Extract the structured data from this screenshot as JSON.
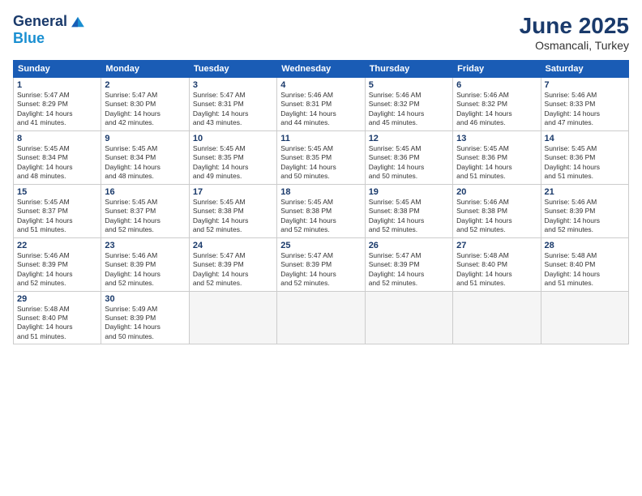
{
  "logo": {
    "line1": "General",
    "line2": "Blue"
  },
  "title": "June 2025",
  "subtitle": "Osmancali, Turkey",
  "weekdays": [
    "Sunday",
    "Monday",
    "Tuesday",
    "Wednesday",
    "Thursday",
    "Friday",
    "Saturday"
  ],
  "days": [
    {
      "num": "",
      "info": ""
    },
    {
      "num": "",
      "info": ""
    },
    {
      "num": "",
      "info": ""
    },
    {
      "num": "",
      "info": ""
    },
    {
      "num": "",
      "info": ""
    },
    {
      "num": "",
      "info": ""
    },
    {
      "num": "",
      "info": ""
    },
    {
      "num": "1",
      "info": "Sunrise: 5:47 AM\nSunset: 8:29 PM\nDaylight: 14 hours\nand 41 minutes."
    },
    {
      "num": "2",
      "info": "Sunrise: 5:47 AM\nSunset: 8:30 PM\nDaylight: 14 hours\nand 42 minutes."
    },
    {
      "num": "3",
      "info": "Sunrise: 5:47 AM\nSunset: 8:31 PM\nDaylight: 14 hours\nand 43 minutes."
    },
    {
      "num": "4",
      "info": "Sunrise: 5:46 AM\nSunset: 8:31 PM\nDaylight: 14 hours\nand 44 minutes."
    },
    {
      "num": "5",
      "info": "Sunrise: 5:46 AM\nSunset: 8:32 PM\nDaylight: 14 hours\nand 45 minutes."
    },
    {
      "num": "6",
      "info": "Sunrise: 5:46 AM\nSunset: 8:32 PM\nDaylight: 14 hours\nand 46 minutes."
    },
    {
      "num": "7",
      "info": "Sunrise: 5:46 AM\nSunset: 8:33 PM\nDaylight: 14 hours\nand 47 minutes."
    },
    {
      "num": "8",
      "info": "Sunrise: 5:45 AM\nSunset: 8:34 PM\nDaylight: 14 hours\nand 48 minutes."
    },
    {
      "num": "9",
      "info": "Sunrise: 5:45 AM\nSunset: 8:34 PM\nDaylight: 14 hours\nand 48 minutes."
    },
    {
      "num": "10",
      "info": "Sunrise: 5:45 AM\nSunset: 8:35 PM\nDaylight: 14 hours\nand 49 minutes."
    },
    {
      "num": "11",
      "info": "Sunrise: 5:45 AM\nSunset: 8:35 PM\nDaylight: 14 hours\nand 50 minutes."
    },
    {
      "num": "12",
      "info": "Sunrise: 5:45 AM\nSunset: 8:36 PM\nDaylight: 14 hours\nand 50 minutes."
    },
    {
      "num": "13",
      "info": "Sunrise: 5:45 AM\nSunset: 8:36 PM\nDaylight: 14 hours\nand 51 minutes."
    },
    {
      "num": "14",
      "info": "Sunrise: 5:45 AM\nSunset: 8:36 PM\nDaylight: 14 hours\nand 51 minutes."
    },
    {
      "num": "15",
      "info": "Sunrise: 5:45 AM\nSunset: 8:37 PM\nDaylight: 14 hours\nand 51 minutes."
    },
    {
      "num": "16",
      "info": "Sunrise: 5:45 AM\nSunset: 8:37 PM\nDaylight: 14 hours\nand 52 minutes."
    },
    {
      "num": "17",
      "info": "Sunrise: 5:45 AM\nSunset: 8:38 PM\nDaylight: 14 hours\nand 52 minutes."
    },
    {
      "num": "18",
      "info": "Sunrise: 5:45 AM\nSunset: 8:38 PM\nDaylight: 14 hours\nand 52 minutes."
    },
    {
      "num": "19",
      "info": "Sunrise: 5:45 AM\nSunset: 8:38 PM\nDaylight: 14 hours\nand 52 minutes."
    },
    {
      "num": "20",
      "info": "Sunrise: 5:46 AM\nSunset: 8:38 PM\nDaylight: 14 hours\nand 52 minutes."
    },
    {
      "num": "21",
      "info": "Sunrise: 5:46 AM\nSunset: 8:39 PM\nDaylight: 14 hours\nand 52 minutes."
    },
    {
      "num": "22",
      "info": "Sunrise: 5:46 AM\nSunset: 8:39 PM\nDaylight: 14 hours\nand 52 minutes."
    },
    {
      "num": "23",
      "info": "Sunrise: 5:46 AM\nSunset: 8:39 PM\nDaylight: 14 hours\nand 52 minutes."
    },
    {
      "num": "24",
      "info": "Sunrise: 5:47 AM\nSunset: 8:39 PM\nDaylight: 14 hours\nand 52 minutes."
    },
    {
      "num": "25",
      "info": "Sunrise: 5:47 AM\nSunset: 8:39 PM\nDaylight: 14 hours\nand 52 minutes."
    },
    {
      "num": "26",
      "info": "Sunrise: 5:47 AM\nSunset: 8:39 PM\nDaylight: 14 hours\nand 52 minutes."
    },
    {
      "num": "27",
      "info": "Sunrise: 5:48 AM\nSunset: 8:40 PM\nDaylight: 14 hours\nand 51 minutes."
    },
    {
      "num": "28",
      "info": "Sunrise: 5:48 AM\nSunset: 8:40 PM\nDaylight: 14 hours\nand 51 minutes."
    },
    {
      "num": "29",
      "info": "Sunrise: 5:48 AM\nSunset: 8:40 PM\nDaylight: 14 hours\nand 51 minutes."
    },
    {
      "num": "30",
      "info": "Sunrise: 5:49 AM\nSunset: 8:39 PM\nDaylight: 14 hours\nand 50 minutes."
    },
    {
      "num": "",
      "info": ""
    },
    {
      "num": "",
      "info": ""
    },
    {
      "num": "",
      "info": ""
    },
    {
      "num": "",
      "info": ""
    },
    {
      "num": "",
      "info": ""
    }
  ]
}
